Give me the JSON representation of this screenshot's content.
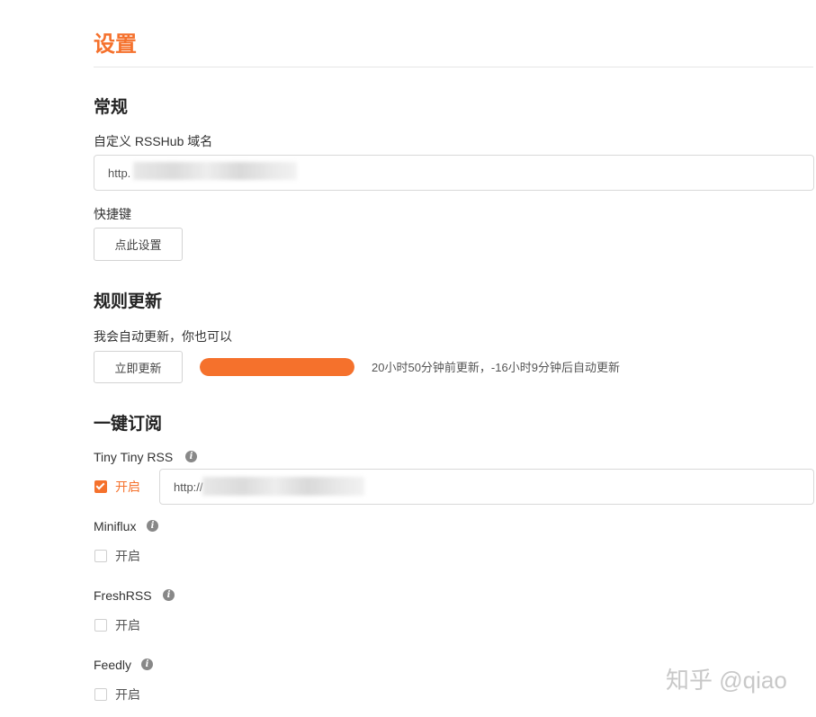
{
  "title": "设置",
  "general": {
    "heading": "常规",
    "domain_label": "自定义 RSSHub 域名",
    "domain_value": "http.",
    "shortcut_label": "快捷键",
    "shortcut_button": "点此设置"
  },
  "rules_update": {
    "heading": "规则更新",
    "desc": "我会自动更新，你也可以",
    "update_button": "立即更新",
    "progress": 1.0,
    "status_text": "20小时50分钟前更新，-16小时9分钟后自动更新"
  },
  "subscribe": {
    "heading": "一键订阅",
    "items": [
      {
        "name": "Tiny Tiny RSS",
        "enable_label": "开启",
        "checked": true,
        "url_value": "http://"
      },
      {
        "name": "Miniflux",
        "enable_label": "开启",
        "checked": false
      },
      {
        "name": "FreshRSS",
        "enable_label": "开启",
        "checked": false
      },
      {
        "name": "Feedly",
        "enable_label": "开启",
        "checked": false
      }
    ],
    "info_icon_glyph": "i"
  },
  "watermark": "知乎 @qiao",
  "colors": {
    "accent": "#f5712c",
    "text": "#333333",
    "border": "#d9d9d9"
  },
  "icons": {
    "info": "info-icon",
    "check": "check-icon"
  }
}
